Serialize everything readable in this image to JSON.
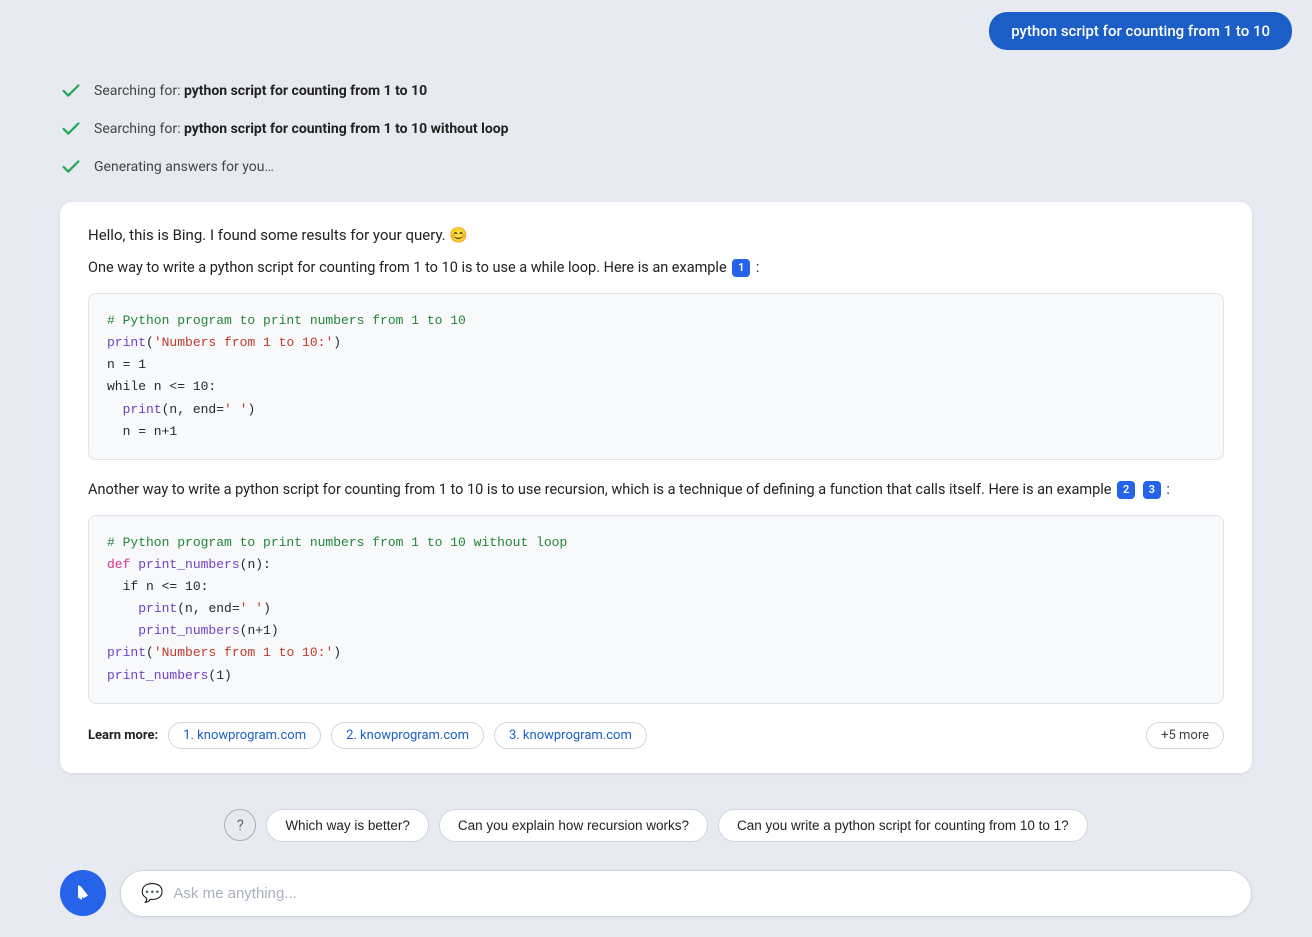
{
  "header": {
    "user_query": "python script for counting from 1 to 10"
  },
  "search_statuses": [
    {
      "id": "status1",
      "text_prefix": "Searching for: ",
      "text_bold": "python script for counting from 1 to 10"
    },
    {
      "id": "status2",
      "text_prefix": "Searching for: ",
      "text_bold": "python script for counting from 1 to 10 without loop"
    },
    {
      "id": "status3",
      "text_prefix": "Generating answers for you…",
      "text_bold": ""
    }
  ],
  "response": {
    "intro": "Hello, this is Bing. I found some results for your query. 😊",
    "paragraph1_before": "One way to write a python script for counting from 1 to 10 is to use a while loop. Here is an example",
    "citation1": "1",
    "paragraph1_after": " :",
    "code1_lines": [
      {
        "type": "comment",
        "text": "# Python program to print numbers from 1 to 10"
      },
      {
        "type": "mixed1",
        "text": "print('Numbers from 1 to 10:')"
      },
      {
        "type": "plain",
        "text": "n = 1"
      },
      {
        "type": "plain",
        "text": "while n <= 10:"
      },
      {
        "type": "plain",
        "text": "  print(n, end=' ')"
      },
      {
        "type": "plain",
        "text": "  n = n+1"
      }
    ],
    "paragraph2_before": "Another way to write a python script for counting from 1 to 10 is to use recursion, which is a technique of defining a function that calls itself. Here is an example",
    "citation2": "2",
    "citation3": "3",
    "paragraph2_after": ":",
    "code2_lines": [
      {
        "type": "comment",
        "text": "# Python program to print numbers from 1 to 10 without loop"
      },
      {
        "type": "mixed2",
        "text": "def print_numbers(n):"
      },
      {
        "type": "plain",
        "text": "  if n <= 10:"
      },
      {
        "type": "plain",
        "text": "    print(n, end=' ')"
      },
      {
        "type": "plain",
        "text": "    print_numbers(n+1)"
      },
      {
        "type": "mixed1",
        "text": "print('Numbers from 1 to 10:')"
      },
      {
        "type": "plain",
        "text": "print_numbers(1)"
      }
    ],
    "learn_more": {
      "label": "Learn more:",
      "links": [
        {
          "id": "link1",
          "text": "1. knowprogram.com"
        },
        {
          "id": "link2",
          "text": "2. knowprogram.com"
        },
        {
          "id": "link3",
          "text": "3. knowprogram.com"
        }
      ],
      "more_badge": "+5 more"
    }
  },
  "suggestions": [
    {
      "id": "s1",
      "text": "Which way is better?"
    },
    {
      "id": "s2",
      "text": "Can you explain how recursion works?"
    },
    {
      "id": "s3",
      "text": "Can you write a python script for counting from 10 to 1?"
    }
  ],
  "input": {
    "placeholder": "Ask me anything..."
  }
}
